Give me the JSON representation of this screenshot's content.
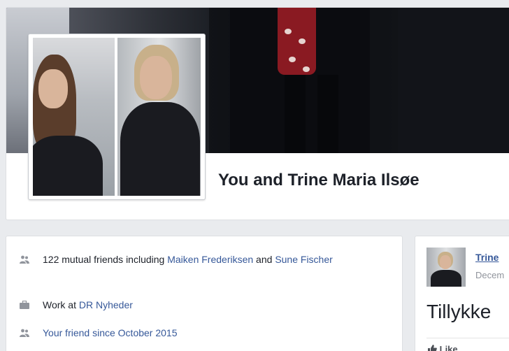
{
  "profile": {
    "name": "You and Trine Maria Ilsøe"
  },
  "intro": {
    "mutual": {
      "prefix": "122 mutual friends including ",
      "friend1": "Maiken Frederiksen",
      "joiner": " and ",
      "friend2": "Sune Fischer"
    },
    "work": {
      "prefix": "Work at ",
      "employer": "DR Nyheder"
    },
    "since": {
      "text": "Your friend since October 2015"
    }
  },
  "post": {
    "author": "Trine",
    "date": "Decem",
    "text": "Tillykke",
    "like_label": "Like"
  },
  "icons": {
    "mutual": "people-icon",
    "work": "briefcase-icon",
    "since": "people-icon",
    "like": "thumbs-up-icon"
  },
  "colors": {
    "link": "#365899",
    "icon": "#90949c",
    "text": "#1d2129"
  }
}
